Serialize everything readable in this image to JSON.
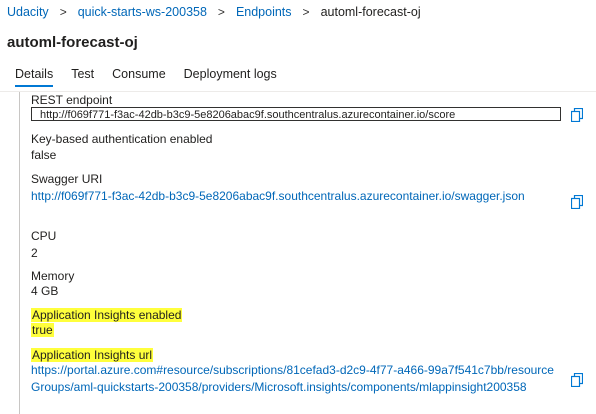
{
  "breadcrumb": {
    "items": [
      "Udacity",
      "quick-starts-ws-200358",
      "Endpoints"
    ],
    "current": "automl-forecast-oj",
    "separator": ">"
  },
  "page": {
    "title": "automl-forecast-oj"
  },
  "tabs": [
    {
      "label": "Details",
      "active": true
    },
    {
      "label": "Test",
      "active": false
    },
    {
      "label": "Consume",
      "active": false
    },
    {
      "label": "Deployment logs",
      "active": false
    }
  ],
  "details": {
    "rest_endpoint": {
      "label": "REST endpoint",
      "value": "http://f069f771-f3ac-42db-b3c9-5e8206abac9f.southcentralus.azurecontainer.io/score"
    },
    "key_auth": {
      "label": "Key-based authentication enabled",
      "value": "false"
    },
    "swagger": {
      "label": "Swagger URI",
      "value": "http://f069f771-f3ac-42db-b3c9-5e8206abac9f.southcentralus.azurecontainer.io/swagger.json"
    },
    "cpu": {
      "label": "CPU",
      "value": "2"
    },
    "memory": {
      "label": "Memory",
      "value": "4 GB"
    },
    "app_insights_enabled": {
      "label": "Application Insights enabled",
      "value": "true"
    },
    "app_insights_url": {
      "label": "Application Insights url",
      "value": "https://portal.azure.com#resource/subscriptions/81cefad3-d2c9-4f77-a466-99a7f541c7bb/resourceGroups/aml-quickstarts-200358/providers/Microsoft.insights/components/mlappinsight200358"
    }
  },
  "icons": {
    "copy": "copy-icon"
  },
  "colors": {
    "link": "#0067b8",
    "accent": "#0078d4",
    "highlight": "#ffff3c"
  }
}
